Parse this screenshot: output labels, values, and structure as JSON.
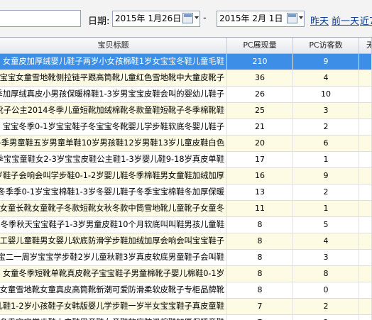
{
  "toolbar": {
    "date_label": "日期:",
    "start_date": "2015年 1月26日",
    "end_date": "2015年 2月 1日",
    "dash": "-",
    "links": [
      "昨天",
      "前一天",
      "近7"
    ]
  },
  "table": {
    "headers": [
      "宝贝标题",
      "PC展现量",
      "PC访客数",
      "无"
    ],
    "rows": [
      {
        "title": "女童皮加厚绒婴儿鞋子两岁小女孩棉鞋1岁女宝宝冬鞋儿童毛鞋",
        "pv": "210",
        "uv": "9",
        "selected": true
      },
      {
        "title": "宝宝女童雪地靴侧拉链平跟高筒靴儿童红色雪地靴中大童皮靴子",
        "pv": "36",
        "uv": "4"
      },
      {
        "title": "冬季加厚绒真皮小男孩保暖棉鞋1-3岁男宝宝皮鞋会叫的婴幼儿鞋子",
        "pv": "26",
        "uv": "10"
      },
      {
        "title": "女童靴子公主2014冬季儿童短靴加绒棉靴冬款童鞋短靴子冬季棉靴鞋",
        "pv": "25",
        "uv": "3"
      },
      {
        "title": "宝宝冬季0-1岁宝宝鞋子冬宝宝冬靴婴儿学步鞋软底冬婴儿鞋子",
        "pv": "21",
        "uv": "2"
      },
      {
        "title": "冬季男童鞋五岁男童单鞋10岁男孩鞋12岁男鞋13岁儿童皮鞋白色",
        "pv": "20",
        "uv": "6"
      },
      {
        "title": "冬季宝宝童鞋女2-3岁宝宝皮鞋公主鞋1-3岁婴儿鞋9-18岁真皮单鞋",
        "pv": "17",
        "uv": "1"
      },
      {
        "title": "2岁鞋子会响会叫学步鞋0-1-2岁婴儿鞋冬季棉鞋男女童鞋加绒加厚",
        "pv": "16",
        "uv": "9"
      },
      {
        "title": "冬季季0-1岁宝宝棉鞋1-3岁冬婴儿鞋子冬季宝宝棉鞋冬加厚保暖",
        "pv": "13",
        "uv": "2"
      },
      {
        "title": "女童长靴女童靴子冬款短靴女秋冬款中筒雪地靴儿童靴子女童冬",
        "pv": "11",
        "uv": "1"
      },
      {
        "title": "冬季秋天宝宝鞋子1-3岁男童皮鞋10个月软底叫叫鞋男孩儿童鞋",
        "pv": "8",
        "uv": "5"
      },
      {
        "title": "手工婴儿童鞋男女婴儿软底防滑学步鞋加绒加厚会响会叫宝宝鞋子",
        "pv": "8",
        "uv": "4"
      },
      {
        "title": "宝宝二一周岁宝宝学步鞋2岁儿童秋鞋3岁真皮软底男童鞋子会叫鞋",
        "pv": "8",
        "uv": "3"
      },
      {
        "title": "女童冬季短靴单靴真皮靴子宝宝鞋子男童棉靴子婴儿棉鞋0-1岁",
        "pv": "8",
        "uv": "8"
      },
      {
        "title": "宝宝女童雪地靴女童真皮高筒靴新潮可爱防滑柔软皮靴子专柜品牌靴",
        "pv": "8",
        "uv": "0"
      },
      {
        "title": "婴儿鞋1-2岁小孩鞋子女韩版婴儿学步鞋一岁半女宝宝鞋子真皮童鞋",
        "pv": "7",
        "uv": "2"
      },
      {
        "title": "冬季宝宝学步鞋小皮鞋男童鞋女童鞋软底防滑棉鞋加厚保暖童鞋",
        "pv": "7",
        "uv": "2"
      }
    ]
  },
  "colors": {
    "selected_row": "#3d8ee6",
    "alt_row": "#fdfbe3",
    "link": "#0b3b9a"
  },
  "icons": [
    "calendar-icon",
    "dropdown-icon"
  ]
}
